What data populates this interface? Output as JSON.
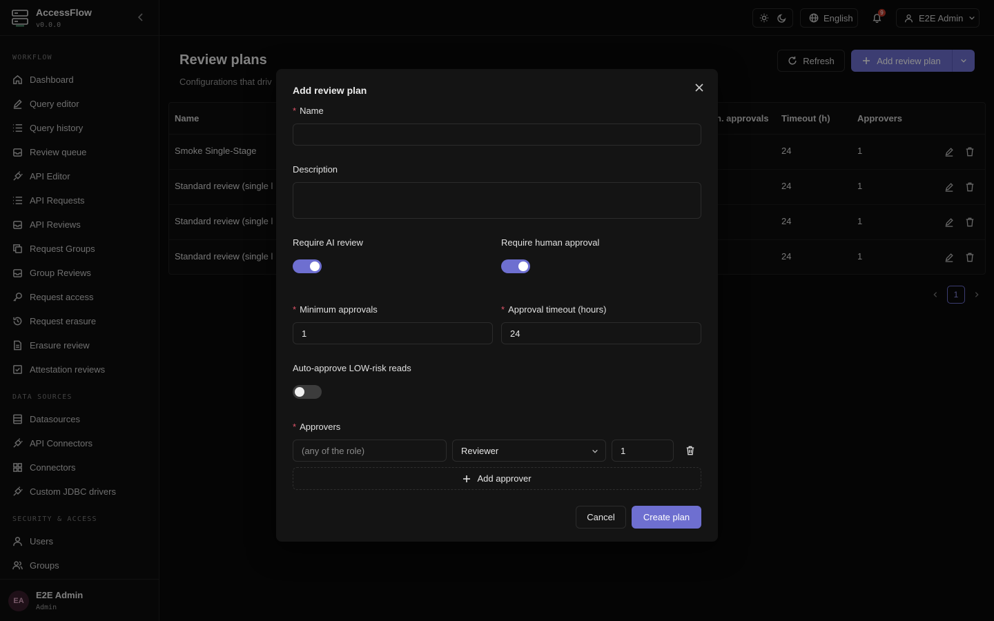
{
  "app": {
    "name": "AccessFlow",
    "version": "v0.0.0"
  },
  "sidebar": {
    "sections": [
      {
        "label": "WORKFLOW",
        "items": [
          {
            "label": "Dashboard",
            "icon": "home-icon"
          },
          {
            "label": "Query editor",
            "icon": "pencil-icon"
          },
          {
            "label": "Query history",
            "icon": "list-icon"
          },
          {
            "label": "Review queue",
            "icon": "inbox-icon"
          },
          {
            "label": "API Editor",
            "icon": "plug-icon"
          },
          {
            "label": "API Requests",
            "icon": "list-icon"
          },
          {
            "label": "API Reviews",
            "icon": "inbox-icon"
          },
          {
            "label": "Request Groups",
            "icon": "copy-icon"
          },
          {
            "label": "Group Reviews",
            "icon": "inbox-icon"
          },
          {
            "label": "Request access",
            "icon": "key-icon"
          },
          {
            "label": "Request erasure",
            "icon": "history-icon"
          },
          {
            "label": "Erasure review",
            "icon": "document-icon"
          },
          {
            "label": "Attestation reviews",
            "icon": "check-square-icon"
          }
        ]
      },
      {
        "label": "DATA SOURCES",
        "items": [
          {
            "label": "Datasources",
            "icon": "database-icon"
          },
          {
            "label": "API Connectors",
            "icon": "plug-icon"
          },
          {
            "label": "Connectors",
            "icon": "grid-icon"
          },
          {
            "label": "Custom JDBC drivers",
            "icon": "plug-icon"
          }
        ]
      },
      {
        "label": "SECURITY & ACCESS",
        "items": [
          {
            "label": "Users",
            "icon": "user-icon"
          },
          {
            "label": "Groups",
            "icon": "users-icon"
          }
        ]
      }
    ],
    "profile": {
      "initials": "EA",
      "name": "E2E Admin",
      "role": "Admin"
    }
  },
  "header": {
    "language": "English",
    "notification_count": "9",
    "user": "E2E Admin"
  },
  "page": {
    "title": "Review plans",
    "subtitle": "Configurations that driv",
    "refresh_label": "Refresh",
    "add_label": "Add review plan"
  },
  "table": {
    "columns": {
      "name": "Name",
      "min_approvals": "n. approvals",
      "timeout": "Timeout (h)",
      "approvers": "Approvers"
    },
    "rows": [
      {
        "name": "Smoke Single-Stage",
        "timeout": "24",
        "approvers": "1"
      },
      {
        "name": "Standard review (single l",
        "timeout": "24",
        "approvers": "1"
      },
      {
        "name": "Standard review (single l",
        "timeout": "24",
        "approvers": "1"
      },
      {
        "name": "Standard review (single l",
        "timeout": "24",
        "approvers": "1"
      }
    ],
    "page": "1"
  },
  "modal": {
    "title": "Add review plan",
    "name_label": "Name",
    "name_value": "",
    "description_label": "Description",
    "description_value": "",
    "ai_review_label": "Require AI review",
    "ai_review_on": true,
    "human_approval_label": "Require human approval",
    "human_approval_on": true,
    "min_approvals_label": "Minimum approvals",
    "min_approvals_value": "1",
    "timeout_label": "Approval timeout (hours)",
    "timeout_value": "24",
    "auto_approve_label": "Auto-approve LOW-risk reads",
    "auto_approve_on": false,
    "approvers_label": "Approvers",
    "approver_user_placeholder": "(any of the role)",
    "approver_role": "Reviewer",
    "approver_stage": "1",
    "add_approver_label": "Add approver",
    "cancel_label": "Cancel",
    "create_label": "Create plan"
  },
  "colors": {
    "accent": "#6e6fd0",
    "danger": "#e0556a",
    "background": "#0a0a0a"
  }
}
